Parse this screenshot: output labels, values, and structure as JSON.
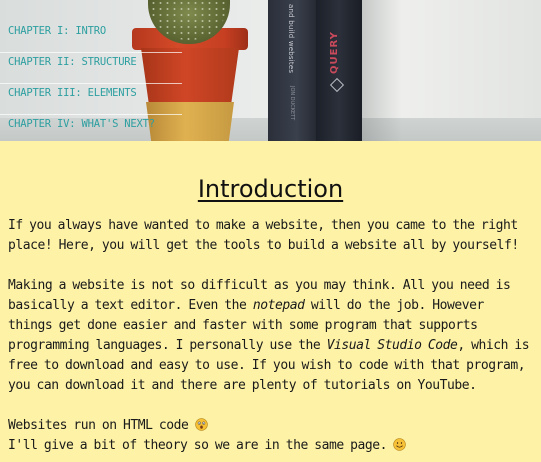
{
  "nav": {
    "items": [
      {
        "label": "CHAPTER I: INTRO"
      },
      {
        "label": "CHAPTER II: STRUCTURE"
      },
      {
        "label": "CHAPTER III: ELEMENTS"
      },
      {
        "label": "CHAPTER IV: WHAT'S NEXT?"
      }
    ]
  },
  "hero": {
    "book1_spine": "and build websites",
    "book1_author": "JON DUCKETT",
    "book2_spine": "QUERY"
  },
  "main": {
    "title": "Introduction",
    "paragraph1": "If you always have wanted to make a website, then you came to the right place! Here, you will get the tools to build a website all by yourself!",
    "paragraph2_part1": "Making a website is not so difficult as you may think. All you need is basically a text editor. Even the ",
    "paragraph2_em1": "notepad",
    "paragraph2_part2": " will do the job. However things get done easier and faster with some program that supports programming languages. I personally use the ",
    "paragraph2_em2": "Visual Studio Code",
    "paragraph2_part3": ", which is free to download and easy to use. If you wish to code with that program, you can download it and there are plenty of tutorials on YouTube.",
    "line3": "Websites run on HTML code",
    "line4": "I'll give a bit of theory so we are in the same page."
  },
  "icons": {
    "emoji1": "astonished-face-icon",
    "emoji2": "smiling-face-icon"
  },
  "colors": {
    "nav_link": "#2d9fa0",
    "content_bg": "#fdf2a6"
  }
}
